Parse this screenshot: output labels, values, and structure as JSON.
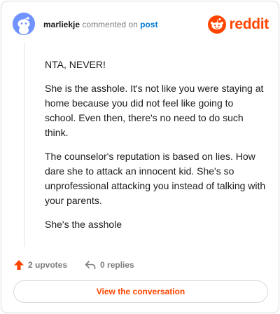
{
  "header": {
    "username": "marliekje",
    "action_text": "commented on",
    "target_link": "post",
    "brand_name": "reddit"
  },
  "icons": {
    "avatar": "snoo-avatar-icon",
    "brand": "reddit-logo-icon",
    "upvote": "upvote-arrow-icon",
    "reply": "reply-arrow-icon"
  },
  "colors": {
    "brand": "#ff4500",
    "link": "#0079d3",
    "muted": "#7c7c7c",
    "avatar_bg": "#7193ff"
  },
  "comment": {
    "paragraphs": [
      "NTA, NEVER!",
      "She is the asshole. It's not like you were staying at home because you did not feel like going to school. Even then, there's no need to do such think.",
      "The counselor's reputation is based on lies. How dare she to attack an innocent kid. She's so unprofessional attacking you instead of talking with your parents.",
      "She's the asshole"
    ]
  },
  "actions": {
    "upvotes_label": "2 upvotes",
    "replies_label": "0 replies"
  },
  "cta": {
    "label": "View the conversation"
  }
}
